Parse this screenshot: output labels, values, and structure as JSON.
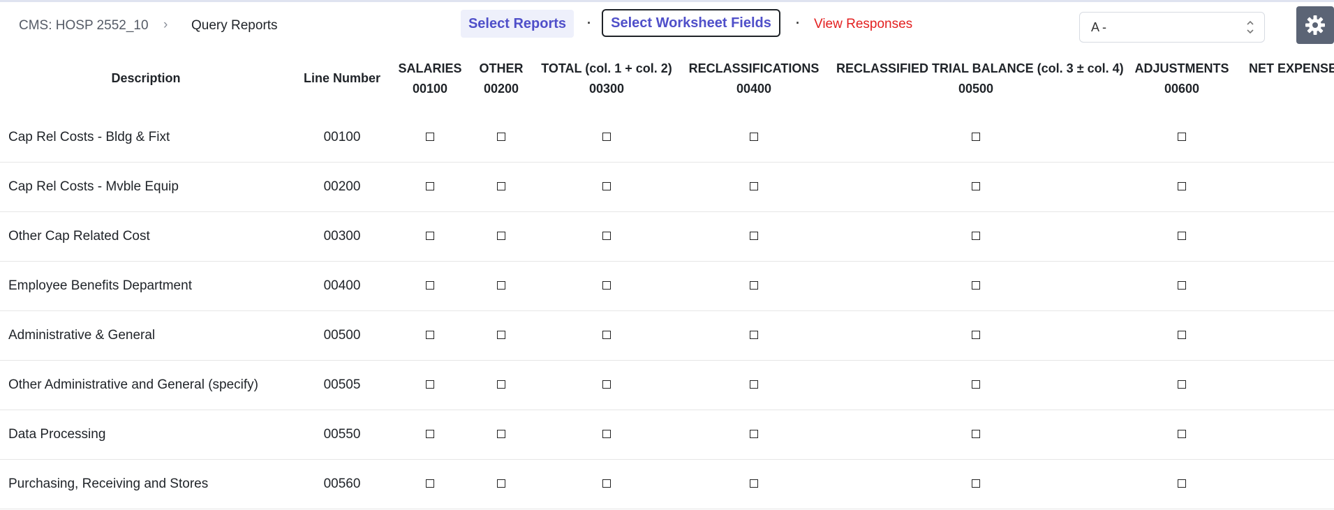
{
  "breadcrumb": {
    "root": "CMS: HOSP 2552_10",
    "separator": "›",
    "current": "Query Reports"
  },
  "nav": {
    "select_reports": "Select Reports",
    "separator": "·",
    "select_fields": "Select Worksheet Fields",
    "view_responses": "View Responses"
  },
  "worksheet_select": {
    "value": "A -"
  },
  "settings": {
    "icon": "gear-icon"
  },
  "table": {
    "headers": {
      "description": "Description",
      "line_number": "Line Number",
      "columns": [
        {
          "label": "SALARIES",
          "code": "00100"
        },
        {
          "label": "OTHER",
          "code": "00200"
        },
        {
          "label": "TOTAL (col. 1 + col. 2)",
          "code": "00300"
        },
        {
          "label": "RECLASSIFICATIONS",
          "code": "00400"
        },
        {
          "label": "RECLASSIFIED TRIAL BALANCE (col. 3 ± col. 4)",
          "code": "00500"
        },
        {
          "label": "ADJUSTMENTS",
          "code": "00600"
        },
        {
          "label": "NET EXPENSES",
          "code": ""
        }
      ]
    },
    "rows": [
      {
        "description": "Cap Rel Costs - Bldg & Fixt",
        "line": "00100"
      },
      {
        "description": "Cap Rel Costs - Mvble Equip",
        "line": "00200"
      },
      {
        "description": "Other Cap Related Cost",
        "line": "00300"
      },
      {
        "description": "Employee Benefits Department",
        "line": "00400"
      },
      {
        "description": "Administrative & General",
        "line": "00500"
      },
      {
        "description": "Other Administrative and General (specify)",
        "line": "00505"
      },
      {
        "description": "Data Processing",
        "line": "00550"
      },
      {
        "description": "Purchasing, Receiving and Stores",
        "line": "00560"
      }
    ]
  }
}
